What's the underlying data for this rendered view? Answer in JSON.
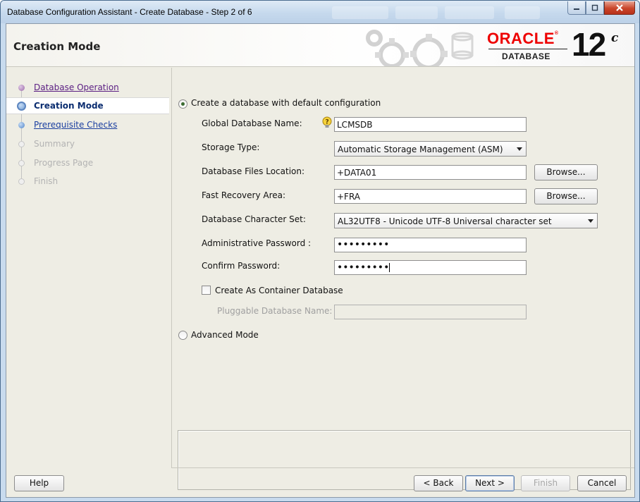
{
  "window": {
    "title": "Database Configuration Assistant - Create Database - Step 2 of 6"
  },
  "header": {
    "page_title": "Creation Mode",
    "brand": "ORACLE",
    "brand_mark": "®",
    "product": "DATABASE",
    "version": "12",
    "version_suffix": "c"
  },
  "nav": {
    "items": [
      {
        "label": "Database Operation",
        "state": "visited"
      },
      {
        "label": "Creation Mode",
        "state": "current"
      },
      {
        "label": "Prerequisite Checks",
        "state": "link"
      },
      {
        "label": "Summary",
        "state": "disabled"
      },
      {
        "label": "Progress Page",
        "state": "disabled"
      },
      {
        "label": "Finish",
        "state": "disabled"
      }
    ]
  },
  "form": {
    "default_config_option": "Create a database with default configuration",
    "default_config_selected": true,
    "global_db_name_label": "Global Database Name:",
    "global_db_name_value": "LCMSDB",
    "storage_type_label": "Storage Type:",
    "storage_type_value": "Automatic Storage Management (ASM)",
    "db_files_location_label": "Database Files Location:",
    "db_files_location_value": "+DATA01",
    "fast_recovery_label": "Fast Recovery Area:",
    "fast_recovery_value": "+FRA",
    "browse_label": "Browse...",
    "charset_label": "Database Character Set:",
    "charset_value": "AL32UTF8 - Unicode UTF-8 Universal character set",
    "admin_password_label": "Administrative Password :",
    "admin_password_value": "•••••••••",
    "confirm_password_label": "Confirm Password:",
    "confirm_password_value": "•••••••••",
    "container_db_label": "Create As Container Database",
    "container_db_checked": false,
    "pluggable_db_label": "Pluggable Database Name:",
    "pluggable_db_value": "",
    "advanced_mode_option": "Advanced Mode",
    "advanced_mode_selected": false
  },
  "buttons": {
    "help": "Help",
    "back": "< Back",
    "next": "Next >",
    "finish": "Finish",
    "cancel": "Cancel"
  },
  "icons": {
    "hint": "lightbulb-hint-icon",
    "minimize": "minimize-icon",
    "maximize": "maximize-icon",
    "close": "close-icon"
  },
  "colors": {
    "brand_red": "#ee0000",
    "nav_visited": "#5a1d82",
    "nav_link": "#1b3fa0",
    "panel_bg": "#eeede4"
  }
}
